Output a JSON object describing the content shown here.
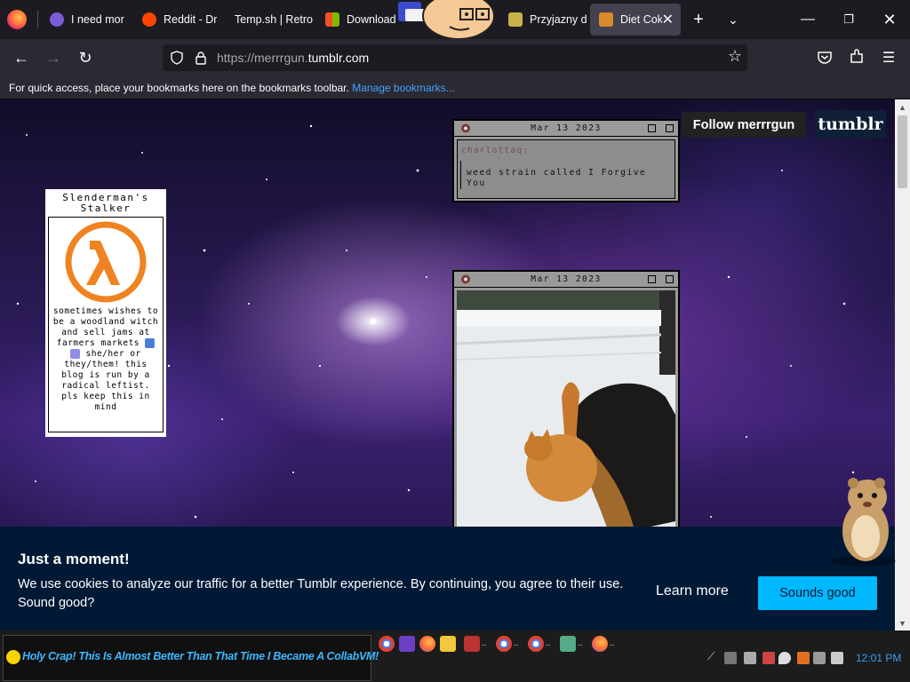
{
  "browser": {
    "tabs": [
      {
        "title": "I need mor",
        "favicon_color": "#7b5cd6",
        "active": false
      },
      {
        "title": "Reddit - Dr",
        "favicon_color": "#ff4500",
        "active": false
      },
      {
        "title": "Temp.sh | Retro",
        "favicon_color": "#1c1b22",
        "active": false
      },
      {
        "title": "Download",
        "favicon_color": "#00a4ef",
        "active": false
      },
      {
        "title": "Przyjazny d",
        "favicon_color": "#c9b24a",
        "active": false
      },
      {
        "title": "Diet Cok",
        "favicon_color": "#d98a2b",
        "active": true
      }
    ],
    "url_prefix": "https://merrrgun.",
    "url_domain": "tumblr.com",
    "bookmarks_hint": "For quick access, place your bookmarks here on the bookmarks toolbar.",
    "manage_bookmarks": "Manage bookmarks..."
  },
  "blog": {
    "title": "Slenderman's Stalker",
    "description_1": "sometimes wishes to be a woodland witch and sell jams at farmers markets",
    "description_2": "she/her or they/them! this blog is run by a radical leftist. pls keep this in mind",
    "logo_color": "#f08321"
  },
  "posts": [
    {
      "date": "Mar 13 2023",
      "author": "charlottaq:",
      "text": "weed strain called I Forgive You"
    },
    {
      "date": "Mar 13 2023"
    }
  ],
  "header": {
    "follow_label": "Follow merrrgun",
    "logo_text": "tumblr"
  },
  "cookie_banner": {
    "title": "Just a moment!",
    "message": "We use cookies to analyze our traffic for a better Tumblr experience. By continuing, you agree to their use. Sound good?",
    "learn_more": "Learn more",
    "accept": "Sounds good"
  },
  "taskbar": {
    "start_text": "Holy Crap! This Is Almost Better Than That Time I Became A CollabVM!",
    "clock": "12:01 PM"
  }
}
